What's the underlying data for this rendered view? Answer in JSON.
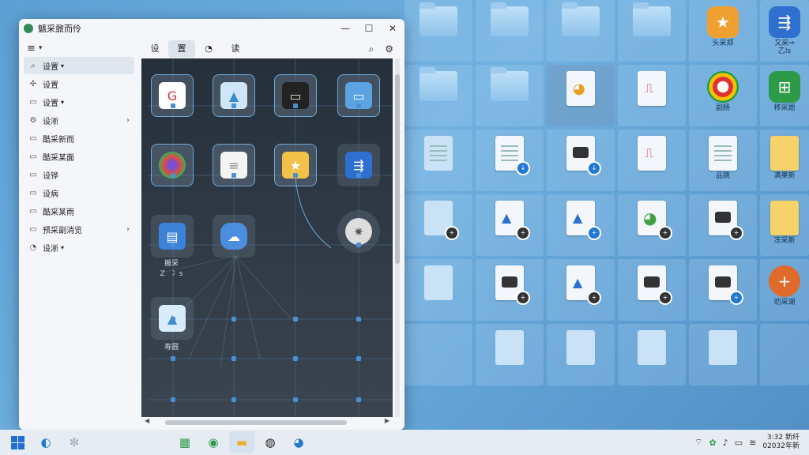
{
  "window": {
    "title": "魑采鼐而伶",
    "controls": {
      "minimize": "—",
      "maximize": "☐",
      "close": "✕"
    }
  },
  "sidebar": {
    "menu_icon": "≡",
    "items": [
      {
        "label": "设置",
        "icon": "search-icon",
        "glyph": "⌕",
        "suffix": "▾",
        "active": true,
        "chevron": ""
      },
      {
        "label": "设置",
        "icon": "apps-icon",
        "glyph": "✣",
        "suffix": "",
        "active": false,
        "chevron": ""
      },
      {
        "label": "设置",
        "icon": "folder-icon",
        "glyph": "▭",
        "suffix": "▾",
        "active": false,
        "chevron": ""
      },
      {
        "label": "设淅",
        "icon": "settings-icon",
        "glyph": "⚙",
        "suffix": "",
        "active": false,
        "chevron": "›"
      },
      {
        "label": "酷采新而",
        "icon": "folder-icon",
        "glyph": "▭",
        "suffix": "",
        "active": false,
        "chevron": ""
      },
      {
        "label": "酷采某面",
        "icon": "folder-icon",
        "glyph": "▭",
        "suffix": "",
        "active": false,
        "chevron": ""
      },
      {
        "label": "设铧",
        "icon": "folder-icon",
        "glyph": "▭",
        "suffix": "",
        "active": false,
        "chevron": ""
      },
      {
        "label": "设病",
        "icon": "folder-icon",
        "glyph": "▭",
        "suffix": "",
        "active": false,
        "chevron": ""
      },
      {
        "label": "酷采某雨",
        "icon": "folder-icon",
        "glyph": "▭",
        "suffix": "",
        "active": false,
        "chevron": ""
      },
      {
        "label": "预采副消览",
        "icon": "folder-icon",
        "glyph": "▭",
        "suffix": "",
        "active": false,
        "chevron": "›"
      },
      {
        "label": "设淅",
        "icon": "shield-icon",
        "glyph": "◔",
        "suffix": "▾",
        "active": false,
        "chevron": ""
      }
    ]
  },
  "tabs": [
    {
      "label": "设",
      "active": false
    },
    {
      "label": "置",
      "active": true
    },
    {
      "label": "◔",
      "active": false
    },
    {
      "label": "读",
      "active": false
    }
  ],
  "toolbar": {
    "search_icon": "⌕",
    "settings_icon": "⚙"
  },
  "graph": {
    "captions": {
      "app_node": "搬采\nZ　冫s",
      "bottom_folder": "寿圆"
    }
  },
  "desktop": {
    "captions": {
      "r0c4": "头采郑",
      "r0c5": "又采⇒\n乙ls",
      "r1c4": "副肠",
      "r1c5": "移采题",
      "r2c4": "品跳",
      "r2c5": "满果新",
      "r3c5": "冻采新",
      "r4c5": "劝采湖"
    }
  },
  "taskbar": {
    "clock_time": "3:32 新纤",
    "clock_date": "02032年新"
  },
  "colors": {
    "accent": "#1f78d1",
    "desktop_bg": "#5c9fd3",
    "graph_bg": "#25303b",
    "node_border": "#6fa8d8"
  }
}
